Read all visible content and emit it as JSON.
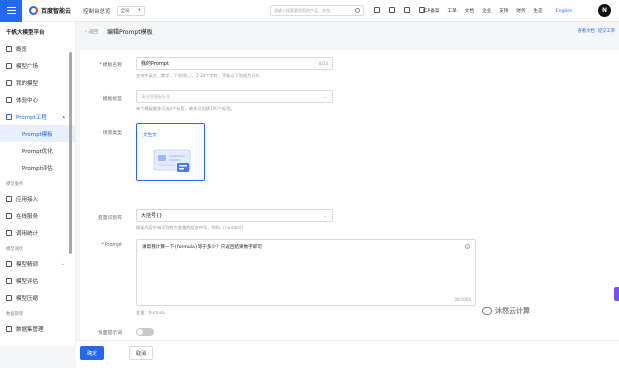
{
  "topbar": {
    "logo_text": "百度智能云",
    "console": "控制台总览",
    "region": "全局",
    "region_caret": "▾",
    "search_placeholder": "请输入搜索要搜索的产品、文档",
    "links": [
      "ICP备案",
      "工单",
      "文档",
      "企业",
      "支持",
      "财务",
      "生态"
    ],
    "english": "English",
    "avatar": "N"
  },
  "sidebar": {
    "title": "千帆大模型平台",
    "items_top": [
      {
        "label": "概览",
        "icon": "grid-icon"
      },
      {
        "label": "模型广场",
        "icon": "cross-icon"
      },
      {
        "label": "我的模型",
        "icon": "gear-icon"
      },
      {
        "label": "体验中心",
        "icon": "flask-icon"
      }
    ],
    "prompt_parent": {
      "label": "Prompt工程",
      "caret": "▴"
    },
    "prompt_children": [
      {
        "label": "Prompt模板",
        "active": true
      },
      {
        "label": "Prompt优化",
        "active": false
      },
      {
        "label": "Prompt评估",
        "active": false
      }
    ],
    "group_service": "模型服务",
    "service_items": [
      {
        "label": "应用接入",
        "icon": "app-icon"
      },
      {
        "label": "在线服务",
        "icon": "cloud-icon"
      },
      {
        "label": "调用统计",
        "icon": "chart-icon"
      }
    ],
    "group_tuning": "模型调优",
    "tuning_items": [
      {
        "label": "模型精调",
        "icon": "tune-icon",
        "caret": "⌄"
      },
      {
        "label": "模型评估",
        "icon": "eval-icon"
      },
      {
        "label": "模型压缩",
        "icon": "compress-icon"
      }
    ],
    "group_data": "数据管理",
    "data_items": [
      {
        "label": "数据集管理",
        "icon": "database-icon"
      }
    ]
  },
  "main": {
    "back": "‹ 返回",
    "page_title": "编辑Prompt模板",
    "help_links": [
      "查看文档",
      "提交工单"
    ],
    "form": {
      "name_label": "模板名称",
      "name_value": "我的Prompt",
      "name_counter": "8/20",
      "name_hint": "支持中英文、数字、下划线(_)，2-20个字符，不能以下划线为开头",
      "tag_label": "模板标签",
      "tag_placeholder": "请选择模板标签",
      "tag_hint": "单个模板最多可选3个标签，最多可创建100个标签。",
      "scene_label": "场景类型",
      "scene_value": "文生文",
      "var_label": "变量识别符",
      "var_value": "大括号{}",
      "var_hint": "模板内容中每识别符为变量的组合符号，例如: {number}",
      "prompt_label": "Prompt",
      "prompt_value": "请帮我计算一下{formula}等于多少？只返回结果数字即可",
      "prompt_counter": "30/1000",
      "variables_note": "变量：formula",
      "negative_label": "负面提示词"
    },
    "footer": {
      "confirm": "确定",
      "cancel": "取消"
    }
  },
  "watermark": "沐然云计算",
  "colors": {
    "brand": "#2468f2",
    "danger": "#e8382b",
    "purple_tab": "#7b4ff0"
  }
}
